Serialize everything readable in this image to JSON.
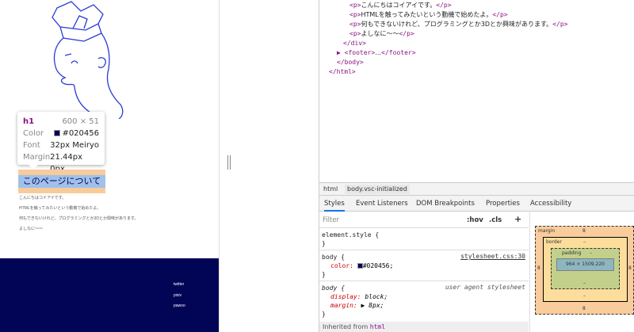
{
  "page": {
    "tooltip": {
      "tag": "h1",
      "size": "600 × 51",
      "color_label": "Color",
      "color_value": "#020456",
      "font_label": "Font",
      "font_value": "32px Meiryo",
      "margin_label": "Margin",
      "margin_value": "21.44px 0px"
    },
    "heading": "このページについて",
    "paragraphs": [
      "こんにちはコイアイです。",
      "HTMLを触ってみたいという動機で始めたよ。",
      "何もできないけれど、プログラミングとか3Dとか興味があります。",
      "よしなに～～"
    ],
    "footer_links": [
      "twitter",
      "pixiv",
      "pawoo"
    ],
    "colors": {
      "footer_bg": "#020456",
      "heading_text": "#020456",
      "margin_overlay": "#f8cb9c",
      "content_overlay": "#9fc1ea"
    }
  },
  "devtools": {
    "code_lines": [
      {
        "open": "<p>",
        "text": "こんにちはコイアイです。",
        "close": "</p>"
      },
      {
        "open": "<p>",
        "text": "HTMLを触ってみたいという動機で始めたよ。",
        "close": "</p>"
      },
      {
        "open": "<p>",
        "text": "何もできないけれど、プログラミングとか3Dとか興味があります。",
        "close": "</p>"
      },
      {
        "open": "<p>",
        "text": "よしなに～～",
        "close": "</p>"
      },
      {
        "open": "</div>",
        "text": "",
        "close": ""
      },
      {
        "open": "▶ <footer>",
        "text": "…",
        "close": "</footer>"
      },
      {
        "open": "</body>",
        "text": "",
        "close": ""
      },
      {
        "open": "</html>",
        "text": "",
        "close": ""
      }
    ],
    "breadcrumbs": [
      "html",
      "body.vsc-initialized"
    ],
    "tabs": [
      "Styles",
      "Event Listeners",
      "DOM Breakpoints",
      "Properties",
      "Accessibility"
    ],
    "filter_placeholder": "Filter",
    "filter_hov": ":hov",
    "filter_cls": ".cls",
    "filter_add": "+",
    "rules": {
      "element_style": "element.style {",
      "close": "}",
      "body_sel": "body {",
      "body_src": "stylesheet.css:30",
      "color_prop": "color:",
      "color_val": "#020456;",
      "ua_sel": "body {",
      "ua_src": "user agent stylesheet",
      "display_prop": "display:",
      "display_val": "block;",
      "margin_prop": "margin:",
      "margin_val": "▶ 8px;"
    },
    "inherited": "Inherited from",
    "inherited_tag": "html",
    "box_model": {
      "margin_label": "margin",
      "margin_top": "8",
      "margin_bottom": "8",
      "margin_left": "8",
      "margin_right": "8",
      "border_label": "border",
      "border_val": "–",
      "padding_label": "padding",
      "padding_val": "–",
      "content": "964 × 1509.220",
      "padding_bottom": "–",
      "border_bottom": "–"
    }
  }
}
